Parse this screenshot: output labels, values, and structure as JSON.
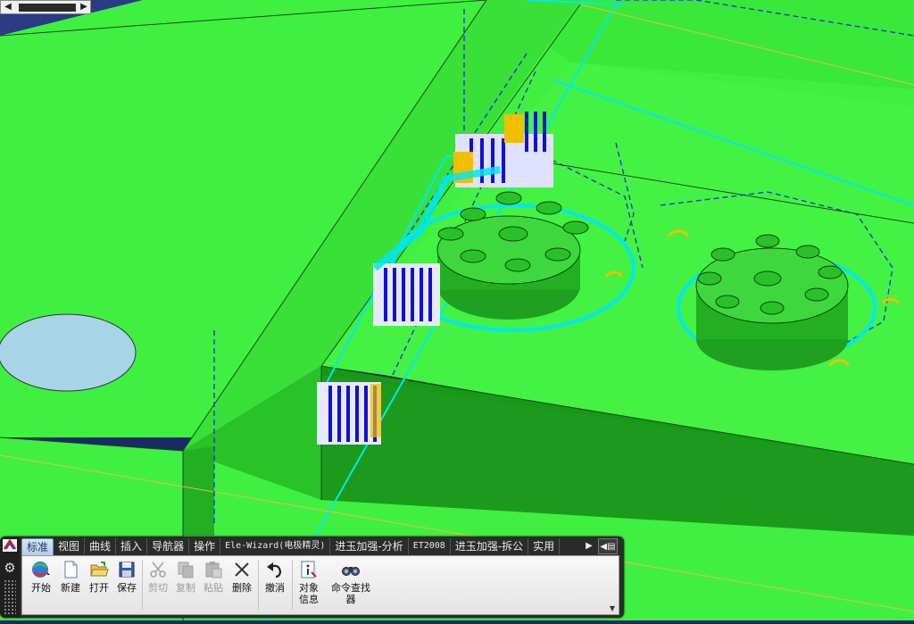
{
  "tabs": [
    {
      "label": "标准",
      "active": true,
      "small": false
    },
    {
      "label": "视图",
      "active": false,
      "small": false
    },
    {
      "label": "曲线",
      "active": false,
      "small": false
    },
    {
      "label": "插入",
      "active": false,
      "small": false
    },
    {
      "label": "导航器",
      "active": false,
      "small": false
    },
    {
      "label": "操作",
      "active": false,
      "small": false
    },
    {
      "label": "Ele-Wizard(电极精灵)",
      "active": false,
      "small": true
    },
    {
      "label": "进玉加强-分析",
      "active": false,
      "small": false
    },
    {
      "label": "ET2008",
      "active": false,
      "small": true
    },
    {
      "label": "进玉加强-拆公",
      "active": false,
      "small": false
    },
    {
      "label": "实用",
      "active": false,
      "small": false
    }
  ],
  "toolbar": {
    "start_label": "开始",
    "new_label": "新建",
    "open_label": "打开",
    "save_label": "保存",
    "cut_label": "剪切",
    "copy_label": "复制",
    "paste_label": "粘贴",
    "delete_label": "删除",
    "undo_label": "撤消",
    "object_info_line1": "对象",
    "object_info_line2": "信息",
    "cmd_finder_line1": "命令查找",
    "cmd_finder_line2": "器"
  },
  "icons": {
    "app": "nx-app-icon",
    "settings": "gear-icon",
    "start": "start-globe-icon",
    "new": "new-file-icon",
    "open": "open-folder-icon",
    "save": "save-disk-icon",
    "cut": "scissors-icon",
    "copy": "copy-icon",
    "paste": "paste-icon",
    "delete": "delete-x-icon",
    "undo": "undo-arrow-icon",
    "object_info": "object-info-icon",
    "cmd_finder": "binoculars-icon"
  },
  "colors": {
    "background": "#1a2a66",
    "model_face": "#40f040",
    "model_shadow": "#1fa01f",
    "edge_cyan": "#00e8f0",
    "hatch_blue": "#1010d0",
    "accent_yellow": "#f0c000",
    "hole_face": "#a8d4e8"
  }
}
